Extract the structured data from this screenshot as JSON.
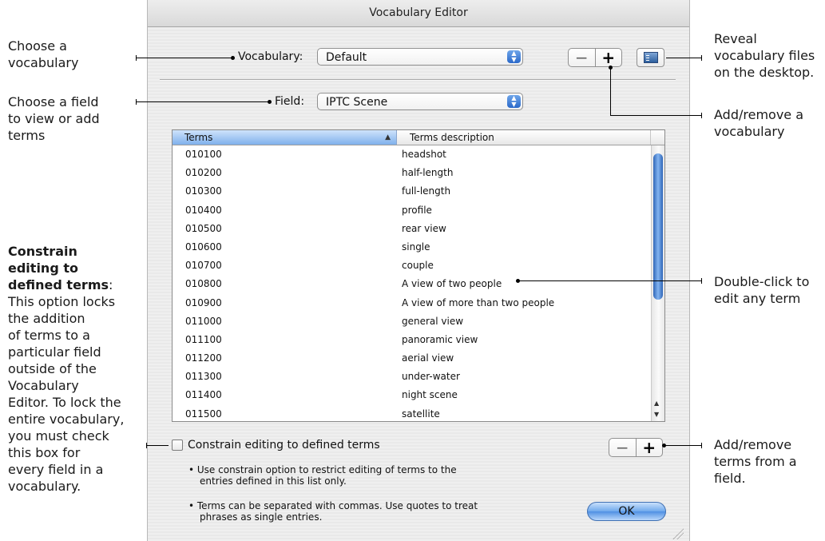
{
  "window": {
    "title": "Vocabulary Editor"
  },
  "vocabulary": {
    "label": "Vocabulary:",
    "value": "Default"
  },
  "field": {
    "label": "Field:",
    "value": "IPTC Scene"
  },
  "vocab_buttons": {
    "remove": "−",
    "add": "+"
  },
  "table": {
    "headers": [
      "Terms",
      "Terms description"
    ],
    "rows": [
      [
        "010100",
        "headshot"
      ],
      [
        "010200",
        "half-length"
      ],
      [
        "010300",
        "full-length"
      ],
      [
        "010400",
        "profile"
      ],
      [
        "010500",
        "rear view"
      ],
      [
        "010600",
        "single"
      ],
      [
        "010700",
        "couple"
      ],
      [
        "010800",
        "A view of two people"
      ],
      [
        "010900",
        "A view of more than two people"
      ],
      [
        "011000",
        "general view"
      ],
      [
        "011100",
        "panoramic view"
      ],
      [
        "011200",
        "aerial view"
      ],
      [
        "011300",
        "under-water"
      ],
      [
        "011400",
        "night scene"
      ],
      [
        "011500",
        "satellite"
      ]
    ]
  },
  "constrain": {
    "label": "Constrain editing to defined terms",
    "checked": false
  },
  "term_buttons": {
    "remove": "−",
    "add": "+"
  },
  "notes": [
    "• Use constrain option to restrict editing of terms to the",
    "entries defined in this list only.",
    "• Terms can be separated with commas. Use quotes to treat",
    "phrases as single entries."
  ],
  "ok_label": "OK",
  "callouts": {
    "choose_vocab": [
      "Choose a",
      "vocabulary"
    ],
    "choose_field": [
      "Choose a field",
      "to view or add",
      "terms"
    ],
    "constrain_title": [
      "Constrain",
      "editing to",
      "defined terms"
    ],
    "constrain_colon": ":",
    "constrain_body": [
      "This option locks",
      "the addition",
      "of terms to a",
      "particular field",
      "outside of the",
      "Vocabulary",
      "Editor. To lock the",
      "entire vocabulary,",
      "you must check",
      "this box for",
      "every field in a",
      "vocabulary."
    ],
    "reveal": [
      "Reveal",
      "vocabulary files",
      "on the desktop."
    ],
    "add_remove_vocab": [
      "Add/remove a",
      "vocabulary"
    ],
    "double_click": [
      "Double-click to",
      "edit any term"
    ],
    "add_remove_terms": [
      "Add/remove",
      "terms from a",
      "field."
    ]
  }
}
